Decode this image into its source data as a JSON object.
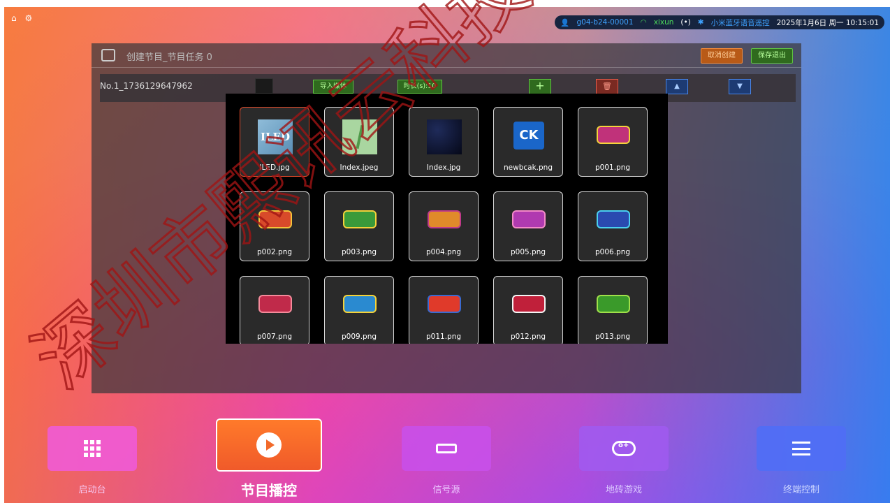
{
  "topbar": {
    "home_icon": "home-icon",
    "settings_icon": "gear-icon",
    "user_id": "g04-b24-00001",
    "wifi_name": "xixun",
    "bluetooth_device": "小米蓝牙语音遥控",
    "datetime": "2025年1月6日 周一 10:15:01"
  },
  "window": {
    "title": "创建节目_节目任务 0",
    "cancel_label": "取消创建",
    "save_label": "保存退出"
  },
  "task": {
    "name": "No.1_1736129647962",
    "import_label": "导入媒体",
    "duration_label": "时长(s):10"
  },
  "media_files": [
    {
      "name": "ILED.jpg",
      "thumb": "ILED",
      "selected": true
    },
    {
      "name": "Index.jpeg",
      "thumb": ""
    },
    {
      "name": "Index.jpg",
      "thumb": ""
    },
    {
      "name": "newbcak.png",
      "thumb": "CK"
    },
    {
      "name": "p001.png",
      "thumb": ""
    },
    {
      "name": "p002.png",
      "thumb": ""
    },
    {
      "name": "p003.png",
      "thumb": ""
    },
    {
      "name": "p004.png",
      "thumb": ""
    },
    {
      "name": "p005.png",
      "thumb": ""
    },
    {
      "name": "p006.png",
      "thumb": ""
    },
    {
      "name": "p007.png",
      "thumb": ""
    },
    {
      "name": "p009.png",
      "thumb": ""
    },
    {
      "name": "p011.png",
      "thumb": ""
    },
    {
      "name": "p012.png",
      "thumb": ""
    },
    {
      "name": "p013.png",
      "thumb": ""
    }
  ],
  "dock": [
    {
      "label": "启动台",
      "icon": "grid-icon",
      "active": false
    },
    {
      "label": "节目播控",
      "icon": "play-icon",
      "active": true
    },
    {
      "label": "信号源",
      "icon": "hdmi-icon",
      "active": false
    },
    {
      "label": "地砖游戏",
      "icon": "gamepad-icon",
      "active": false
    },
    {
      "label": "终端控制",
      "icon": "sliders-icon",
      "active": false
    }
  ],
  "watermark": "深圳市熙讯云科技",
  "colors": {
    "accent_orange": "#f26a2a",
    "save_green": "#5fc442",
    "status_blue": "#3ea2ff"
  }
}
